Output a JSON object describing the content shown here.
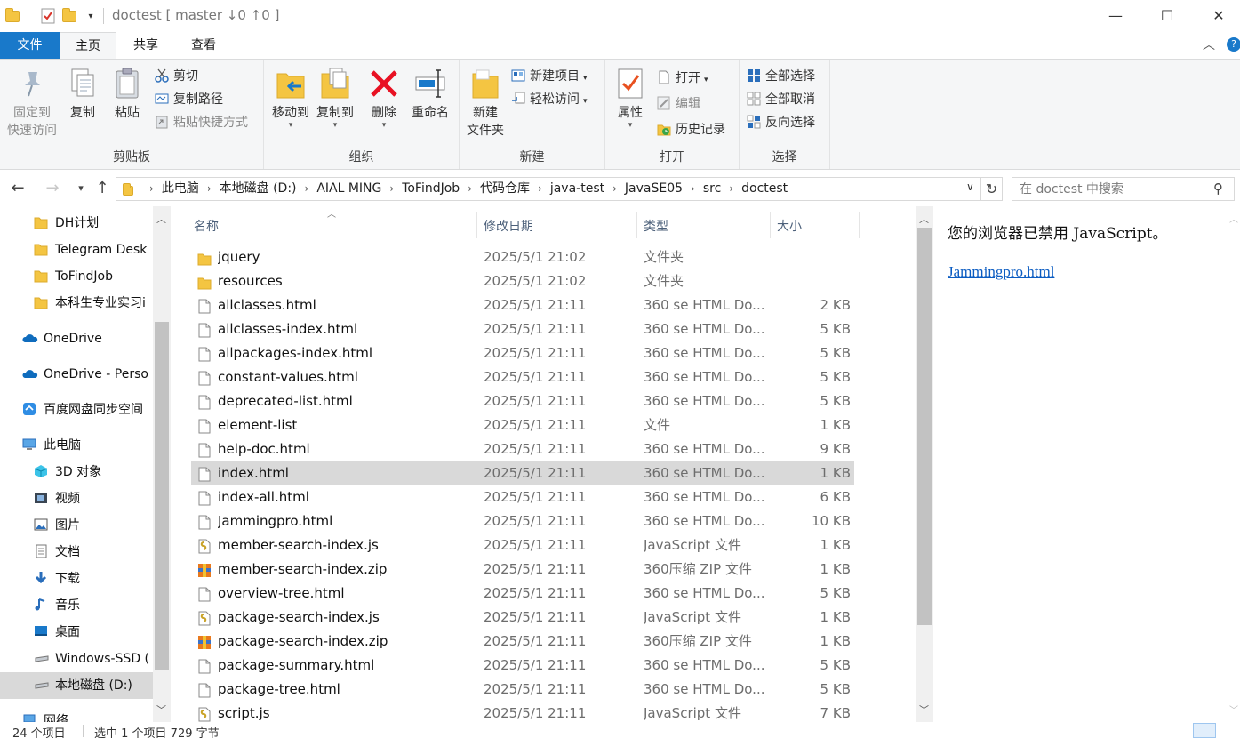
{
  "window": {
    "title": "doctest [ master ↓0 ↑0 ]",
    "minimize": "—",
    "maximize": "☐",
    "close": "✕"
  },
  "ribbon_tabs": {
    "file": "文件",
    "home": "主页",
    "share": "共享",
    "view": "查看"
  },
  "ribbon": {
    "clipboard": {
      "label": "剪贴板",
      "pin_line1": "固定到",
      "pin_line2": "快速访问",
      "copy": "复制",
      "paste": "粘贴",
      "cut": "剪切",
      "copy_path": "复制路径",
      "paste_shortcut": "粘贴快捷方式"
    },
    "organize": {
      "label": "组织",
      "move_to": "移动到",
      "copy_to": "复制到",
      "delete": "删除",
      "rename": "重命名"
    },
    "new": {
      "label": "新建",
      "new_folder_line1": "新建",
      "new_folder_line2": "文件夹",
      "new_item": "新建项目",
      "easy_access": "轻松访问"
    },
    "open": {
      "label": "打开",
      "properties": "属性",
      "open": "打开",
      "edit": "编辑",
      "history": "历史记录"
    },
    "select": {
      "label": "选择",
      "select_all": "全部选择",
      "select_none": "全部取消",
      "invert": "反向选择"
    }
  },
  "address": {
    "crumbs": [
      "此电脑",
      "本地磁盘 (D:)",
      "AIAL MING",
      "ToFindJob",
      "代码仓库",
      "java-test",
      "JavaSE05",
      "src",
      "doctest"
    ],
    "search_placeholder": "在 doctest 中搜索"
  },
  "navpane": {
    "items": [
      {
        "label": "DH计划",
        "icon": "folder-icon"
      },
      {
        "label": "Telegram Desk",
        "icon": "folder-icon"
      },
      {
        "label": "ToFindJob",
        "icon": "folder-icon"
      },
      {
        "label": "本科生专业实习i",
        "icon": "folder-icon"
      },
      {
        "label": "OneDrive",
        "icon": "onedrive-icon"
      },
      {
        "label": "OneDrive - Perso",
        "icon": "onedrive-icon"
      },
      {
        "label": "百度网盘同步空间",
        "icon": "baidu-netdisk-icon"
      },
      {
        "label": "此电脑",
        "icon": "this-pc-icon"
      },
      {
        "label": "3D 对象",
        "icon": "3d-objects-icon"
      },
      {
        "label": "视频",
        "icon": "video-icon"
      },
      {
        "label": "图片",
        "icon": "pictures-icon"
      },
      {
        "label": "文档",
        "icon": "documents-icon"
      },
      {
        "label": "下载",
        "icon": "download-icon"
      },
      {
        "label": "音乐",
        "icon": "music-icon"
      },
      {
        "label": "桌面",
        "icon": "desktop-icon"
      },
      {
        "label": "Windows-SSD (",
        "icon": "drive-icon"
      },
      {
        "label": "本地磁盘 (D:)",
        "icon": "drive-icon"
      },
      {
        "label": "网络",
        "icon": "network-icon"
      }
    ]
  },
  "filelist": {
    "columns": {
      "name": "名称",
      "date": "修改日期",
      "type": "类型",
      "size": "大小"
    },
    "rows": [
      {
        "name": "jquery",
        "date": "2025/5/1 21:02",
        "type": "文件夹",
        "size": "",
        "icon": "folder-icon"
      },
      {
        "name": "resources",
        "date": "2025/5/1 21:02",
        "type": "文件夹",
        "size": "",
        "icon": "folder-icon"
      },
      {
        "name": "allclasses.html",
        "date": "2025/5/1 21:11",
        "type": "360 se HTML Do...",
        "size": "2 KB",
        "icon": "file-icon"
      },
      {
        "name": "allclasses-index.html",
        "date": "2025/5/1 21:11",
        "type": "360 se HTML Do...",
        "size": "5 KB",
        "icon": "file-icon"
      },
      {
        "name": "allpackages-index.html",
        "date": "2025/5/1 21:11",
        "type": "360 se HTML Do...",
        "size": "5 KB",
        "icon": "file-icon"
      },
      {
        "name": "constant-values.html",
        "date": "2025/5/1 21:11",
        "type": "360 se HTML Do...",
        "size": "5 KB",
        "icon": "file-icon"
      },
      {
        "name": "deprecated-list.html",
        "date": "2025/5/1 21:11",
        "type": "360 se HTML Do...",
        "size": "5 KB",
        "icon": "file-icon"
      },
      {
        "name": "element-list",
        "date": "2025/5/1 21:11",
        "type": "文件",
        "size": "1 KB",
        "icon": "file-icon"
      },
      {
        "name": "help-doc.html",
        "date": "2025/5/1 21:11",
        "type": "360 se HTML Do...",
        "size": "9 KB",
        "icon": "file-icon"
      },
      {
        "name": "index.html",
        "date": "2025/5/1 21:11",
        "type": "360 se HTML Do...",
        "size": "1 KB",
        "icon": "file-icon"
      },
      {
        "name": "index-all.html",
        "date": "2025/5/1 21:11",
        "type": "360 se HTML Do...",
        "size": "6 KB",
        "icon": "file-icon"
      },
      {
        "name": "Jammingpro.html",
        "date": "2025/5/1 21:11",
        "type": "360 se HTML Do...",
        "size": "10 KB",
        "icon": "file-icon"
      },
      {
        "name": "member-search-index.js",
        "date": "2025/5/1 21:11",
        "type": "JavaScript 文件",
        "size": "1 KB",
        "icon": "js-file-icon"
      },
      {
        "name": "member-search-index.zip",
        "date": "2025/5/1 21:11",
        "type": "360压缩 ZIP 文件",
        "size": "1 KB",
        "icon": "zip-file-icon"
      },
      {
        "name": "overview-tree.html",
        "date": "2025/5/1 21:11",
        "type": "360 se HTML Do...",
        "size": "5 KB",
        "icon": "file-icon"
      },
      {
        "name": "package-search-index.js",
        "date": "2025/5/1 21:11",
        "type": "JavaScript 文件",
        "size": "1 KB",
        "icon": "js-file-icon"
      },
      {
        "name": "package-search-index.zip",
        "date": "2025/5/1 21:11",
        "type": "360压缩 ZIP 文件",
        "size": "1 KB",
        "icon": "zip-file-icon"
      },
      {
        "name": "package-summary.html",
        "date": "2025/5/1 21:11",
        "type": "360 se HTML Do...",
        "size": "5 KB",
        "icon": "file-icon"
      },
      {
        "name": "package-tree.html",
        "date": "2025/5/1 21:11",
        "type": "360 se HTML Do...",
        "size": "5 KB",
        "icon": "file-icon"
      },
      {
        "name": "script.js",
        "date": "2025/5/1 21:11",
        "type": "JavaScript 文件",
        "size": "7 KB",
        "icon": "js-file-icon"
      }
    ],
    "selected_row": "index.html"
  },
  "preview": {
    "message": "您的浏览器已禁用 JavaScript。",
    "link": "Jammingpro.html"
  },
  "status": {
    "item_count": "24 个项目",
    "selection": "选中 1 个项目 729 字节"
  },
  "colors": {
    "accent": "#1979ca",
    "folder": "#f4c542",
    "selection": "#d9d9d9",
    "header_text": "#4c607a"
  }
}
